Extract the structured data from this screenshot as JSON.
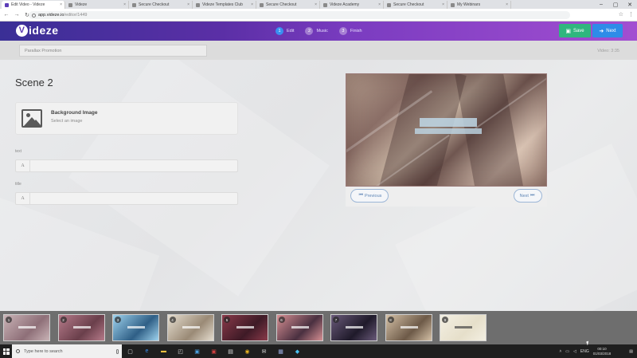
{
  "browser": {
    "tabs": [
      {
        "label": "Edit Video - Videze",
        "active": true
      },
      {
        "label": "Videze",
        "active": false
      },
      {
        "label": "Secure Checkout",
        "active": false
      },
      {
        "label": "Videze Templates Club",
        "active": false
      },
      {
        "label": "Secure Checkout",
        "active": false
      },
      {
        "label": "Videze Academy",
        "active": false
      },
      {
        "label": "Secure Checkout",
        "active": false
      },
      {
        "label": "My Webinars",
        "active": false
      }
    ],
    "url_host": "app.videze.io",
    "url_path": "/editor/1449",
    "window_controls": [
      "–",
      "▢",
      "✕"
    ]
  },
  "app": {
    "logo_mark": "V",
    "logo_text": "ideze",
    "steps": [
      {
        "num": "1",
        "label": "Edit",
        "active": true
      },
      {
        "num": "2",
        "label": "Music",
        "active": false
      },
      {
        "num": "3",
        "label": "Finish",
        "active": false
      }
    ],
    "save_label": "Save",
    "next_label": "Next",
    "save_color": "#2fb67e",
    "next_color": "#2d8ce8"
  },
  "subbar": {
    "project_title": "Parallax Promotion",
    "video_length": "Video: 3:35"
  },
  "editor": {
    "scene_title": "Scene 2",
    "background": {
      "title": "Background Image",
      "subtitle": "Select an image"
    },
    "fields": [
      {
        "label": "text",
        "prefix": "A",
        "value": ""
      },
      {
        "label": "title",
        "prefix": "A",
        "value": ""
      }
    ],
    "preview": {
      "prev_label": "Previous",
      "next_label": "Next"
    }
  },
  "thumbnails": [
    {
      "num": "1",
      "colors": [
        "#c9b3b6",
        "#8e6f78"
      ]
    },
    {
      "num": "2",
      "colors": [
        "#b67b8a",
        "#6a3f4b"
      ]
    },
    {
      "num": "3",
      "colors": [
        "#9fd3ee",
        "#2f5f86"
      ]
    },
    {
      "num": "4",
      "colors": [
        "#e5ddcf",
        "#9a8a76"
      ]
    },
    {
      "num": "5",
      "colors": [
        "#8a3a4a",
        "#3e1a26"
      ]
    },
    {
      "num": "6",
      "colors": [
        "#d68f93",
        "#4a3040"
      ]
    },
    {
      "num": "7",
      "colors": [
        "#6a5a7a",
        "#1f1a2a"
      ]
    },
    {
      "num": "8",
      "colors": [
        "#d4c0a6",
        "#6d5a48"
      ]
    },
    {
      "num": "9",
      "colors": [
        "#f3efe2",
        "#e6dfca"
      ]
    }
  ],
  "taskbar": {
    "search_placeholder": "Type here to search",
    "icons": [
      "task-view-icon",
      "edge-icon",
      "file-explorer-icon",
      "store-icon",
      "app-icon-1",
      "app-icon-2",
      "app-icon-3",
      "chrome-icon",
      "mail-icon",
      "app-icon-4",
      "app-icon-5"
    ],
    "lang": "ENG",
    "time": "00:10",
    "date": "01/03/2018"
  }
}
